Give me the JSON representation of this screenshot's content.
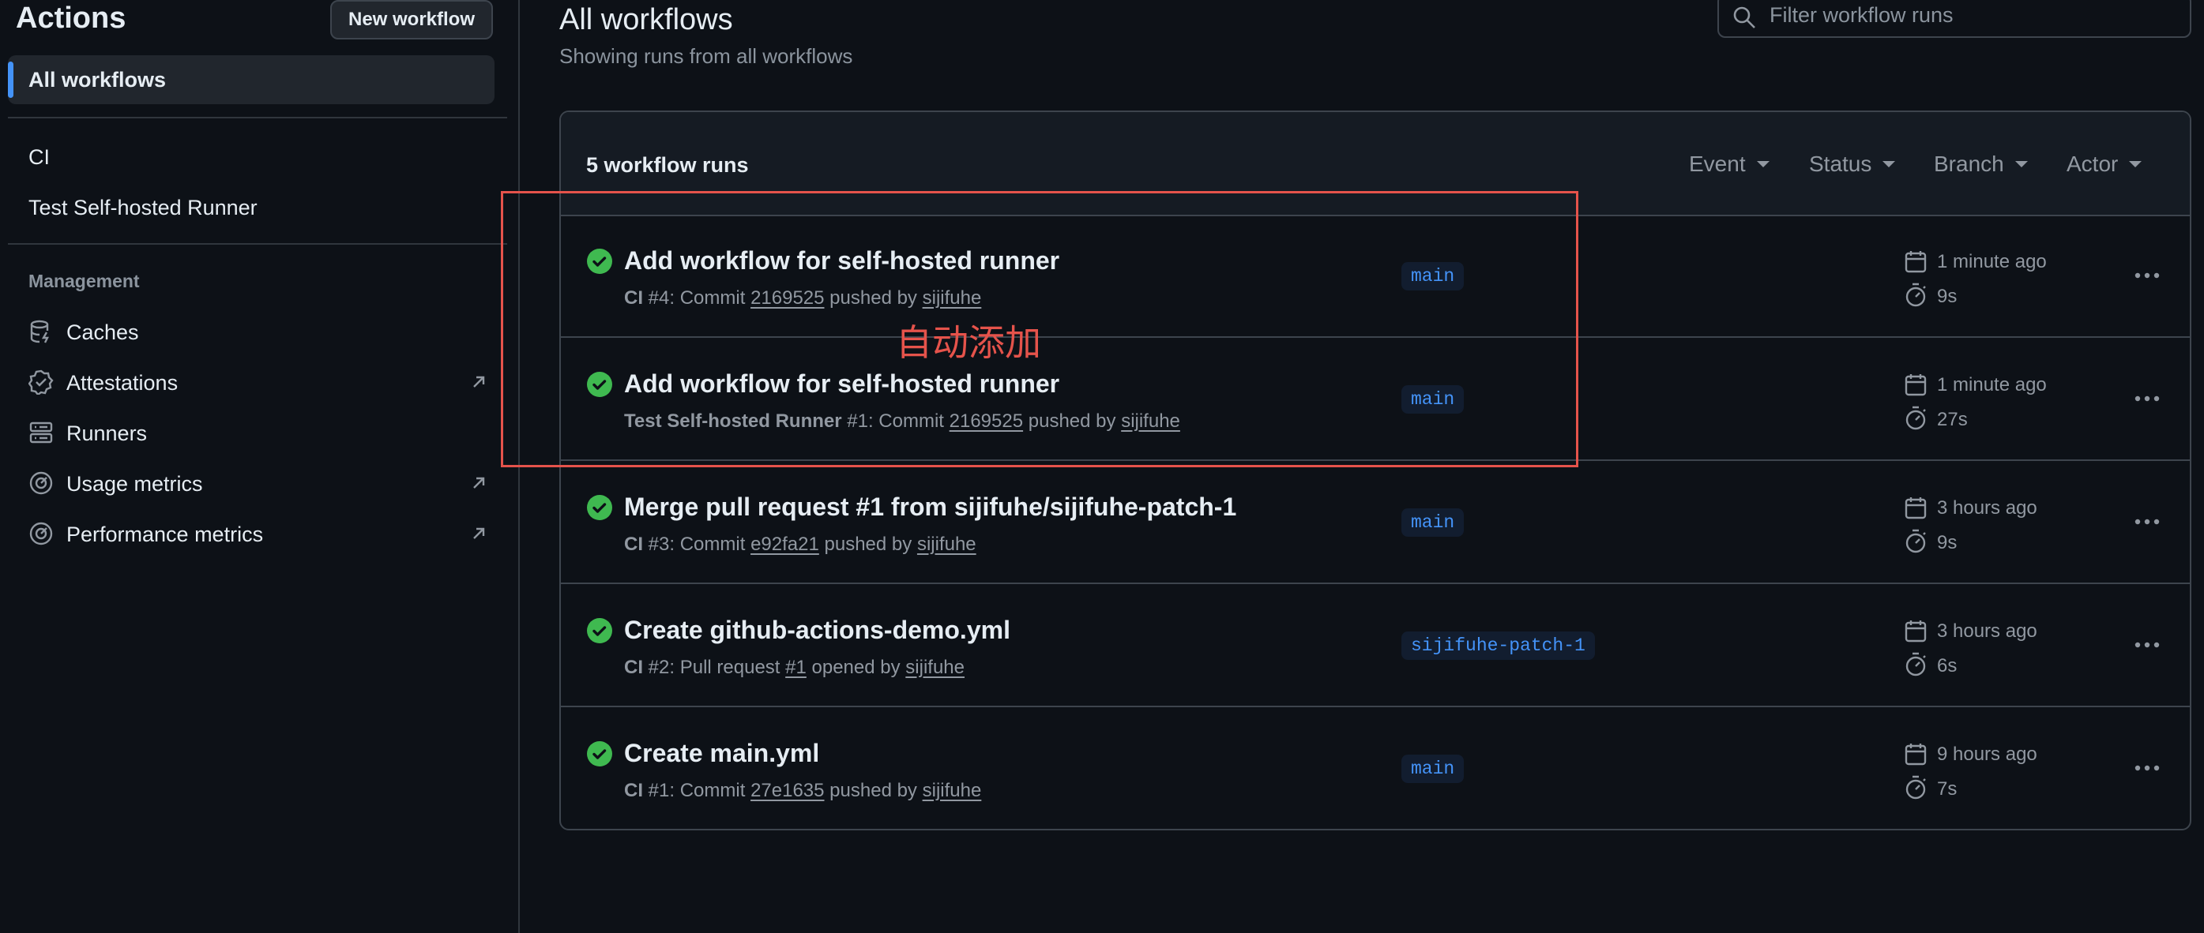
{
  "sidebar": {
    "title": "Actions",
    "new_workflow_button": "New workflow",
    "all_workflows": "All workflows",
    "workflows": [
      "CI",
      "Test Self-hosted Runner"
    ],
    "management_heading": "Management",
    "management": [
      {
        "label": "Caches",
        "icon": "database-icon",
        "external": false
      },
      {
        "label": "Attestations",
        "icon": "verified-icon",
        "external": true
      },
      {
        "label": "Runners",
        "icon": "server-icon",
        "external": false
      },
      {
        "label": "Usage metrics",
        "icon": "meter-icon",
        "external": true
      },
      {
        "label": "Performance metrics",
        "icon": "meter-icon",
        "external": true
      }
    ]
  },
  "main": {
    "title": "All workflows",
    "subtitle": "Showing runs from all workflows",
    "search_placeholder": "Filter workflow runs",
    "runs_count": "5 workflow runs",
    "filters": [
      "Event",
      "Status",
      "Branch",
      "Actor"
    ],
    "runs": [
      {
        "title": "Add workflow for self-hosted runner",
        "workflow": "CI",
        "run": "#4",
        "kind": "Commit",
        "ref": "2169525",
        "action": "pushed by",
        "user": "sijifuhe",
        "branch": "main",
        "time": "1 minute ago",
        "duration": "9s"
      },
      {
        "title": "Add workflow for self-hosted runner",
        "workflow": "Test Self-hosted Runner",
        "run": "#1",
        "kind": "Commit",
        "ref": "2169525",
        "action": "pushed by",
        "user": "sijifuhe",
        "branch": "main",
        "time": "1 minute ago",
        "duration": "27s"
      },
      {
        "title": "Merge pull request #1 from sijifuhe/sijifuhe-patch-1",
        "workflow": "CI",
        "run": "#3",
        "kind": "Commit",
        "ref": "e92fa21",
        "action": "pushed by",
        "user": "sijifuhe",
        "branch": "main",
        "time": "3 hours ago",
        "duration": "9s"
      },
      {
        "title": "Create github-actions-demo.yml",
        "workflow": "CI",
        "run": "#2",
        "kind": "Pull request",
        "ref": "#1",
        "action": "opened by",
        "user": "sijifuhe",
        "branch": "sijifuhe-patch-1",
        "time": "3 hours ago",
        "duration": "6s"
      },
      {
        "title": "Create main.yml",
        "workflow": "CI",
        "run": "#1",
        "kind": "Commit",
        "ref": "27e1635",
        "action": "pushed by",
        "user": "sijifuhe",
        "branch": "main",
        "time": "9 hours ago",
        "duration": "7s"
      }
    ]
  },
  "annotation": {
    "text": "自动添加",
    "color": "#e5534b"
  },
  "colors": {
    "background": "#0d1117",
    "success": "#3fb950",
    "accent": "#4493f8",
    "muted": "#9198a1"
  }
}
